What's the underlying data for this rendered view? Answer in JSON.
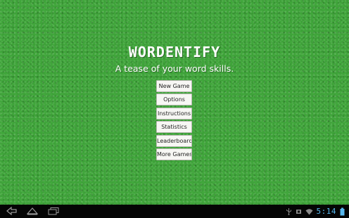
{
  "app": {
    "title": "WORDENTIFY",
    "tagline": "A tease of your word skills."
  },
  "menu": {
    "items": [
      {
        "label": "New Game"
      },
      {
        "label": "Options"
      },
      {
        "label": "Instructions"
      },
      {
        "label": "Statistics"
      },
      {
        "label": "Leaderboard"
      },
      {
        "label": "More Games"
      }
    ]
  },
  "system_bar": {
    "clock": "5:14",
    "icons": [
      "back-icon",
      "home-icon",
      "recent-apps-icon",
      "usb-icon",
      "notification-icon",
      "wifi-icon",
      "battery-icon"
    ],
    "clock_color": "#58b8ee"
  },
  "colors": {
    "background": "#3fa63a",
    "button_bg": "#f7f7f4",
    "system_bar": "#050505"
  }
}
